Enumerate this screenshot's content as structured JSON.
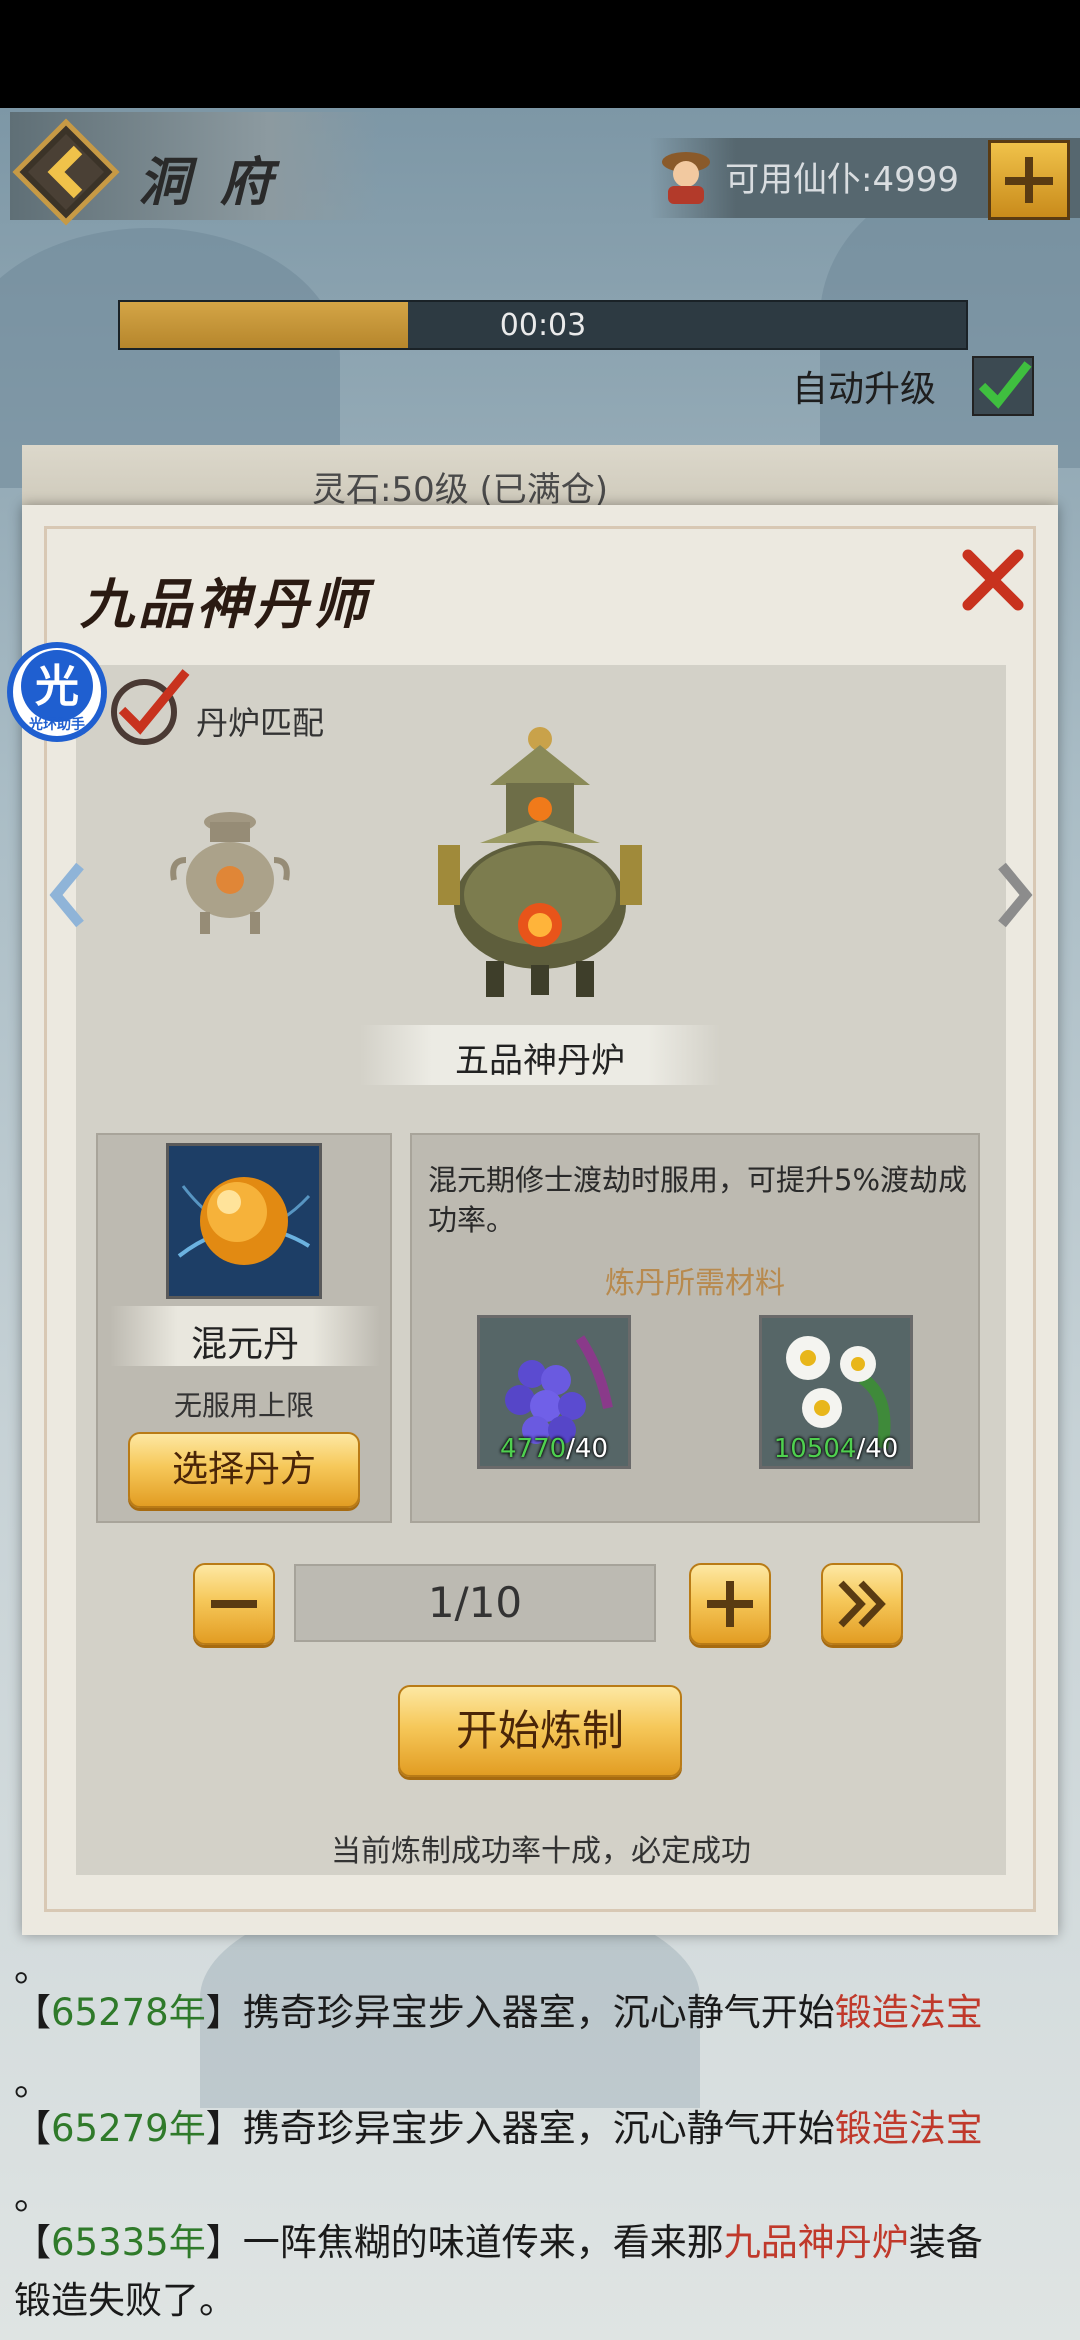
{
  "header": {
    "title": "洞府",
    "currency_label": "可用仙仆:4999"
  },
  "progress": {
    "time": "00:03",
    "fill_fraction": 0.34
  },
  "auto_upgrade": {
    "label": "自动升级",
    "checked": true
  },
  "stone_status": "灵石:50级 (已满仓)",
  "dialog": {
    "title": "九品神丹师",
    "badge_text": "光",
    "badge_sub": "光环助手",
    "match_label": "丹炉匹配",
    "furnace_name": "五品神丹炉",
    "pill": {
      "name": "混元丹",
      "limit": "无服用上限",
      "select_button": "选择丹方"
    },
    "description": "混元期修士渡劫时服用，可提升5%渡劫成功率。",
    "materials_title": "炼丹所需材料",
    "materials": [
      {
        "icon": "berry-icon",
        "have": "4770",
        "need": "/40"
      },
      {
        "icon": "flower-icon",
        "have": "10504",
        "need": "/40"
      }
    ],
    "quantity": "1/10",
    "start_button": "开始炼制",
    "success_text": "当前炼制成功率十成，必定成功"
  },
  "log": {
    "line0": "。",
    "e1_open": "【",
    "e1_year": "65278年",
    "e1_mid": "】携奇珍异宝步入器室，沉心静气开始",
    "e1_hl": "锻造法宝",
    "line2": "。",
    "e2_open": "【",
    "e2_year": "65279年",
    "e2_mid": "】携奇珍异宝步入器室，沉心静气开始",
    "e2_hl": "锻造法宝",
    "line4": "。",
    "e3_open": "【",
    "e3_year": "65335年",
    "e3_mid": "】一阵焦糊的味道传来，看来那",
    "e3_hl": "九品神丹炉",
    "e3_tail": "装备",
    "e3_line2": "锻造失败了。"
  },
  "colors": {
    "year": "#2f7a2a",
    "highlight": "#c0392b",
    "gold": "#f6c85a"
  }
}
